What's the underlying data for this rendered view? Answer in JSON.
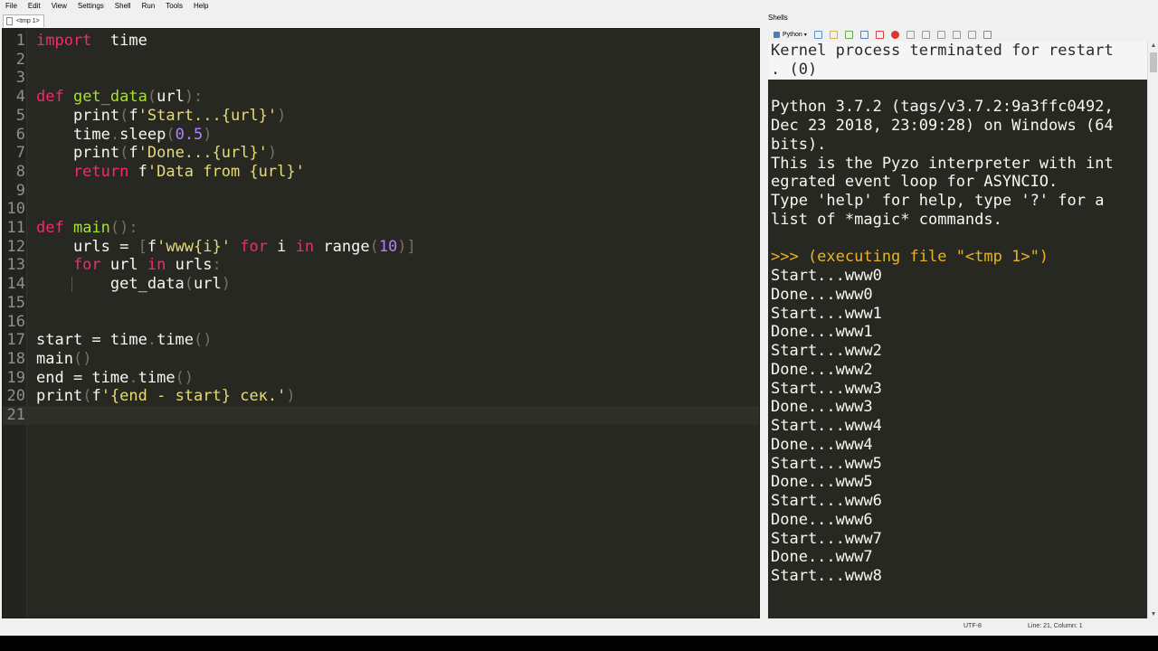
{
  "menu": [
    "File",
    "Edit",
    "View",
    "Settings",
    "Shell",
    "Run",
    "Tools",
    "Help"
  ],
  "editor": {
    "tab_label": "<tmp 1>",
    "lines": [
      {
        "n": "1",
        "tokens": [
          [
            "kw",
            "import"
          ],
          [
            "",
            "  time"
          ]
        ]
      },
      {
        "n": "2",
        "tokens": []
      },
      {
        "n": "3",
        "tokens": []
      },
      {
        "n": "4",
        "tokens": [
          [
            "kw",
            "def "
          ],
          [
            "fn",
            "get_data"
          ],
          [
            "dim",
            "("
          ],
          [
            "",
            "url"
          ],
          [
            "dim",
            "):"
          ]
        ]
      },
      {
        "n": "5",
        "tokens": [
          [
            "",
            "    print"
          ],
          [
            "dim",
            "("
          ],
          [
            "",
            "f"
          ],
          [
            "str",
            "'Start...{url}'"
          ],
          [
            "dim",
            ")"
          ]
        ]
      },
      {
        "n": "6",
        "tokens": [
          [
            "",
            "    time"
          ],
          [
            "dim",
            "."
          ],
          [
            "",
            "sleep"
          ],
          [
            "dim",
            "("
          ],
          [
            "num",
            "0.5"
          ],
          [
            "dim",
            ")"
          ]
        ]
      },
      {
        "n": "7",
        "tokens": [
          [
            "",
            "    print"
          ],
          [
            "dim",
            "("
          ],
          [
            "",
            "f"
          ],
          [
            "str",
            "'Done...{url}'"
          ],
          [
            "dim",
            ")"
          ]
        ]
      },
      {
        "n": "8",
        "tokens": [
          [
            "kw",
            "    return "
          ],
          [
            "",
            "f"
          ],
          [
            "str",
            "'Data from {url}'"
          ]
        ]
      },
      {
        "n": "9",
        "tokens": []
      },
      {
        "n": "10",
        "tokens": []
      },
      {
        "n": "11",
        "tokens": [
          [
            "kw",
            "def "
          ],
          [
            "fn",
            "main"
          ],
          [
            "dim",
            "():"
          ]
        ]
      },
      {
        "n": "12",
        "tokens": [
          [
            "",
            "    urls = "
          ],
          [
            "dim",
            "["
          ],
          [
            "",
            "f"
          ],
          [
            "str",
            "'www{i}'"
          ],
          [
            "kw",
            " for "
          ],
          [
            "",
            "i"
          ],
          [
            "kw",
            " in "
          ],
          [
            "",
            "range"
          ],
          [
            "dim",
            "("
          ],
          [
            "num",
            "10"
          ],
          [
            "dim",
            ")]"
          ]
        ]
      },
      {
        "n": "13",
        "tokens": [
          [
            "kw",
            "    for "
          ],
          [
            "",
            "url"
          ],
          [
            "kw",
            " in "
          ],
          [
            "",
            "urls"
          ],
          [
            "dim",
            ":"
          ]
        ]
      },
      {
        "n": "14",
        "tokens": [
          [
            "",
            "        get_data"
          ],
          [
            "dim",
            "("
          ],
          [
            "",
            "url"
          ],
          [
            "dim",
            ")"
          ]
        ]
      },
      {
        "n": "15",
        "tokens": []
      },
      {
        "n": "16",
        "tokens": []
      },
      {
        "n": "17",
        "tokens": [
          [
            "",
            "start = time"
          ],
          [
            "dim",
            "."
          ],
          [
            "",
            "time"
          ],
          [
            "dim",
            "()"
          ]
        ]
      },
      {
        "n": "18",
        "tokens": [
          [
            "",
            "main"
          ],
          [
            "dim",
            "()"
          ]
        ]
      },
      {
        "n": "19",
        "tokens": [
          [
            "",
            "end = time"
          ],
          [
            "dim",
            "."
          ],
          [
            "",
            "time"
          ],
          [
            "dim",
            "()"
          ]
        ]
      },
      {
        "n": "20",
        "tokens": [
          [
            "",
            "print"
          ],
          [
            "dim",
            "("
          ],
          [
            "",
            "f"
          ],
          [
            "str",
            "'{end - start} сек.'"
          ],
          [
            "dim",
            ")"
          ]
        ]
      },
      {
        "n": "21",
        "tokens": []
      }
    ],
    "current_line": 21
  },
  "shells": {
    "title": "Shells",
    "tab_label": "Python",
    "lines": [
      {
        "t": "Kernel process terminated for restart",
        "c": "faded"
      },
      {
        "t": ". (0)",
        "c": "faded"
      },
      {
        "t": "",
        "c": ""
      },
      {
        "t": "Python 3.7.2 (tags/v3.7.2:9a3ffc0492,",
        "c": ""
      },
      {
        "t": "Dec 23 2018, 23:09:28) on Windows (64",
        "c": ""
      },
      {
        "t": "bits).",
        "c": ""
      },
      {
        "t": "This is the Pyzo interpreter with int",
        "c": ""
      },
      {
        "t": "egrated event loop for ASYNCIO.",
        "c": ""
      },
      {
        "t": "Type 'help' for help, type '?' for a",
        "c": ""
      },
      {
        "t": "list of *magic* commands.",
        "c": ""
      },
      {
        "t": "",
        "c": ""
      },
      {
        "t": ">>> (executing file \"<tmp 1>\")",
        "c": "prompt"
      },
      {
        "t": "Start...www0",
        "c": ""
      },
      {
        "t": "Done...www0",
        "c": ""
      },
      {
        "t": "Start...www1",
        "c": ""
      },
      {
        "t": "Done...www1",
        "c": ""
      },
      {
        "t": "Start...www2",
        "c": ""
      },
      {
        "t": "Done...www2",
        "c": ""
      },
      {
        "t": "Start...www3",
        "c": ""
      },
      {
        "t": "Done...www3",
        "c": ""
      },
      {
        "t": "Start...www4",
        "c": ""
      },
      {
        "t": "Done...www4",
        "c": ""
      },
      {
        "t": "Start...www5",
        "c": ""
      },
      {
        "t": "Done...www5",
        "c": ""
      },
      {
        "t": "Start...www6",
        "c": ""
      },
      {
        "t": "Done...www6",
        "c": ""
      },
      {
        "t": "Start...www7",
        "c": ""
      },
      {
        "t": "Done...www7",
        "c": ""
      },
      {
        "t": "Start...www8",
        "c": ""
      }
    ]
  },
  "status": {
    "encoding": "UTF-8",
    "position": "Line: 21, Column: 1"
  },
  "toolbar_icons": [
    "new-shell-icon",
    "copy-icon",
    "paste-icon",
    "settings-icon",
    "clear-icon",
    "close-shell-icon",
    "interrupt-icon",
    "restart-icon",
    "terminate-icon",
    "debug-step-icon",
    "debug-stop-icon",
    "list-icon"
  ],
  "colors": {
    "editor_bg": "#272822",
    "keyword": "#f92672",
    "function": "#a6e22e",
    "string": "#e6db74",
    "number": "#ae81ff",
    "prompt": "#e6b428"
  }
}
